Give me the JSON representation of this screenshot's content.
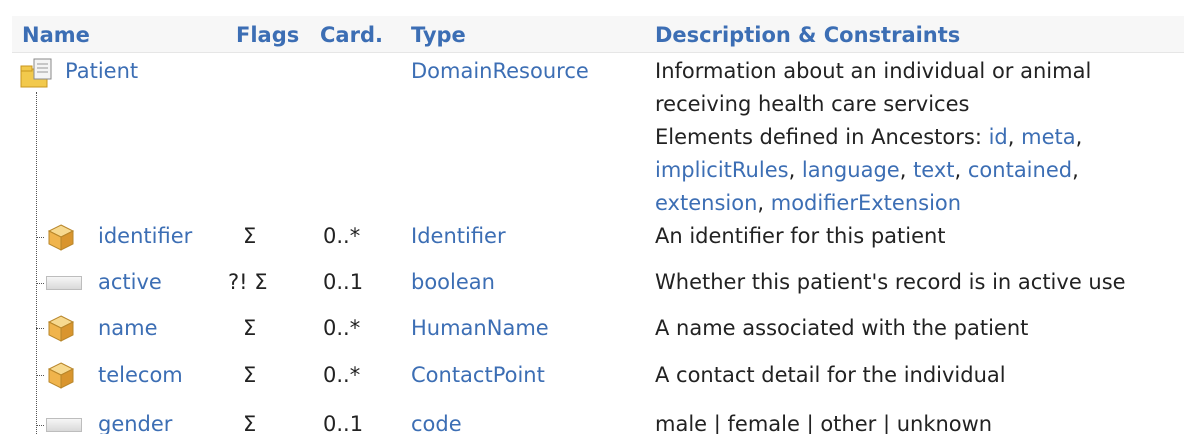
{
  "header": {
    "name": "Name",
    "flags": "Flags",
    "card": "Card.",
    "type": "Type",
    "description": "Description & Constraints"
  },
  "root": {
    "name": "Patient",
    "type": "DomainResource",
    "desc_line1": "Information about an individual or animal",
    "desc_line2": "receiving health care services",
    "ancestors_prefix": "Elements defined in Ancestors: ",
    "ancestors": [
      "id",
      "meta",
      "implicitRules",
      "language",
      "text",
      "contained",
      "extension",
      "modifierExtension"
    ],
    "sep": ", ",
    "end": ","
  },
  "rows": [
    {
      "name": "identifier",
      "flags": "Σ",
      "card": "0..*",
      "type": "Identifier",
      "desc": "An identifier for this patient",
      "icon": "cube-icon"
    },
    {
      "name": "active",
      "flags": "?! Σ",
      "card": "0..1",
      "type": "boolean",
      "desc": "Whether this patient's record is in active use",
      "icon": "primitive-icon"
    },
    {
      "name": "name",
      "flags": "Σ",
      "card": "0..*",
      "type": "HumanName",
      "desc": "A name associated with the patient",
      "icon": "cube-icon"
    },
    {
      "name": "telecom",
      "flags": "Σ",
      "card": "0..*",
      "type": "ContactPoint",
      "desc": "A contact detail for the individual",
      "icon": "cube-icon"
    },
    {
      "name": "gender",
      "flags": "Σ",
      "card": "0..1",
      "type": "code",
      "desc": "male | female | other | unknown",
      "icon": "primitive-icon"
    }
  ],
  "colors": {
    "link": "#3c6eb4",
    "header_bg": "#f7f7f7",
    "text": "#222222"
  }
}
